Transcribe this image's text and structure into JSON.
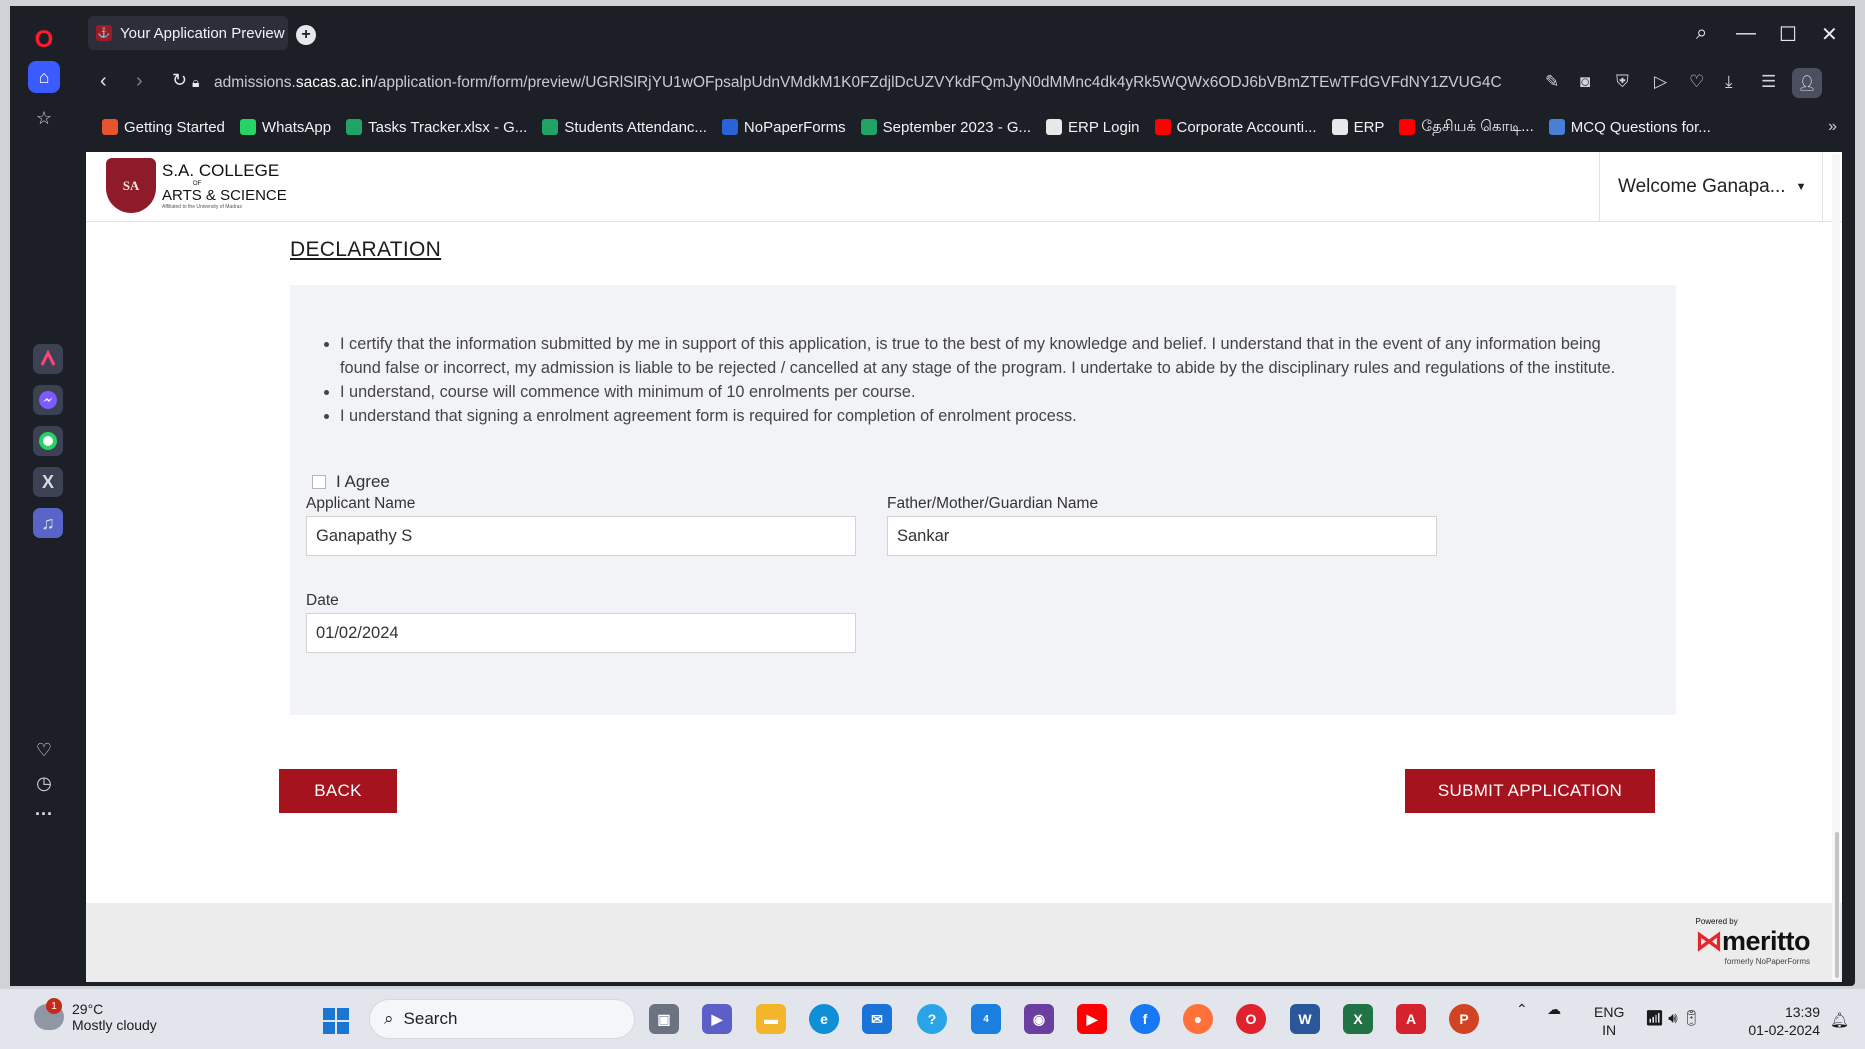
{
  "browser": {
    "tab_title": "Your Application Preview",
    "url_prefix": "admissions.",
    "url_domain": "sacas.ac.in",
    "url_path": "/application-form/form/preview/UGRlSlRjYU1wOFpsalpUdnVMdkM1K0FZdjlDcUZVYkdFQmJyN0dMMnc4dk4yRk5WQWx6ODJ6bVBmZTEwTFdGVFdNY1ZVUG4C",
    "bookmarks": [
      {
        "label": "Getting Started",
        "color": "#e8542e"
      },
      {
        "label": "WhatsApp",
        "color": "#25d366"
      },
      {
        "label": "Tasks Tracker.xlsx - G...",
        "color": "#1fa463"
      },
      {
        "label": "Students Attendanc...",
        "color": "#1fa463"
      },
      {
        "label": "NoPaperForms",
        "color": "#2a62d8"
      },
      {
        "label": "September 2023 - G...",
        "color": "#1fa463"
      },
      {
        "label": "ERP Login",
        "color": "#e8e8e8"
      },
      {
        "label": "Corporate Accounti...",
        "color": "#ff0000"
      },
      {
        "label": "ERP",
        "color": "#e8e8e8"
      },
      {
        "label": "தேசியக் கொடி...",
        "color": "#ff0000"
      },
      {
        "label": "MCQ Questions for...",
        "color": "#4a7fd6"
      }
    ],
    "overflow_icon": "double-chevron-right-icon"
  },
  "site": {
    "logo_title": "S.A. COLLEGE",
    "logo_of": "OF",
    "logo_sub": "ARTS & SCIENCE",
    "logo_fine": "Affiliated to the University of Madras",
    "logo_badge": "SA",
    "welcome": "Welcome Ganapa...",
    "brand_color": "#a4131e"
  },
  "declaration": {
    "title": "DECLARATION",
    "items": [
      "I certify that the information submitted by me in support of this application, is true to the best of my knowledge and belief. I understand that in the event of any information being found false or incorrect, my admission is liable to be rejected / cancelled at any stage of the program. I undertake to abide by the disciplinary rules and regulations of the institute.",
      "I understand, course will commence with minimum of 10 enrolments per course.",
      "I understand that signing a enrolment agreement form is required for completion of enrolment process."
    ],
    "agree_label": "I Agree",
    "agree_checked": false
  },
  "form": {
    "applicant_label": "Applicant Name",
    "applicant_value": "Ganapathy S",
    "guardian_label": "Father/Mother/Guardian Name",
    "guardian_value": "Sankar",
    "date_label": "Date",
    "date_value": "01/02/2024"
  },
  "actions": {
    "back": "BACK",
    "submit": "SUBMIT APPLICATION"
  },
  "footer": {
    "powered_by": "Powered by",
    "brand": "meritto",
    "formerly": "formerly NoPaperForms"
  },
  "taskbar": {
    "temperature": "29°C",
    "weather": "Mostly cloudy",
    "notification_count": "1",
    "search_placeholder": "Search",
    "lang_top": "ENG",
    "lang_bottom": "IN",
    "time": "13:39",
    "date": "01-02-2024",
    "badge_count": "4"
  }
}
